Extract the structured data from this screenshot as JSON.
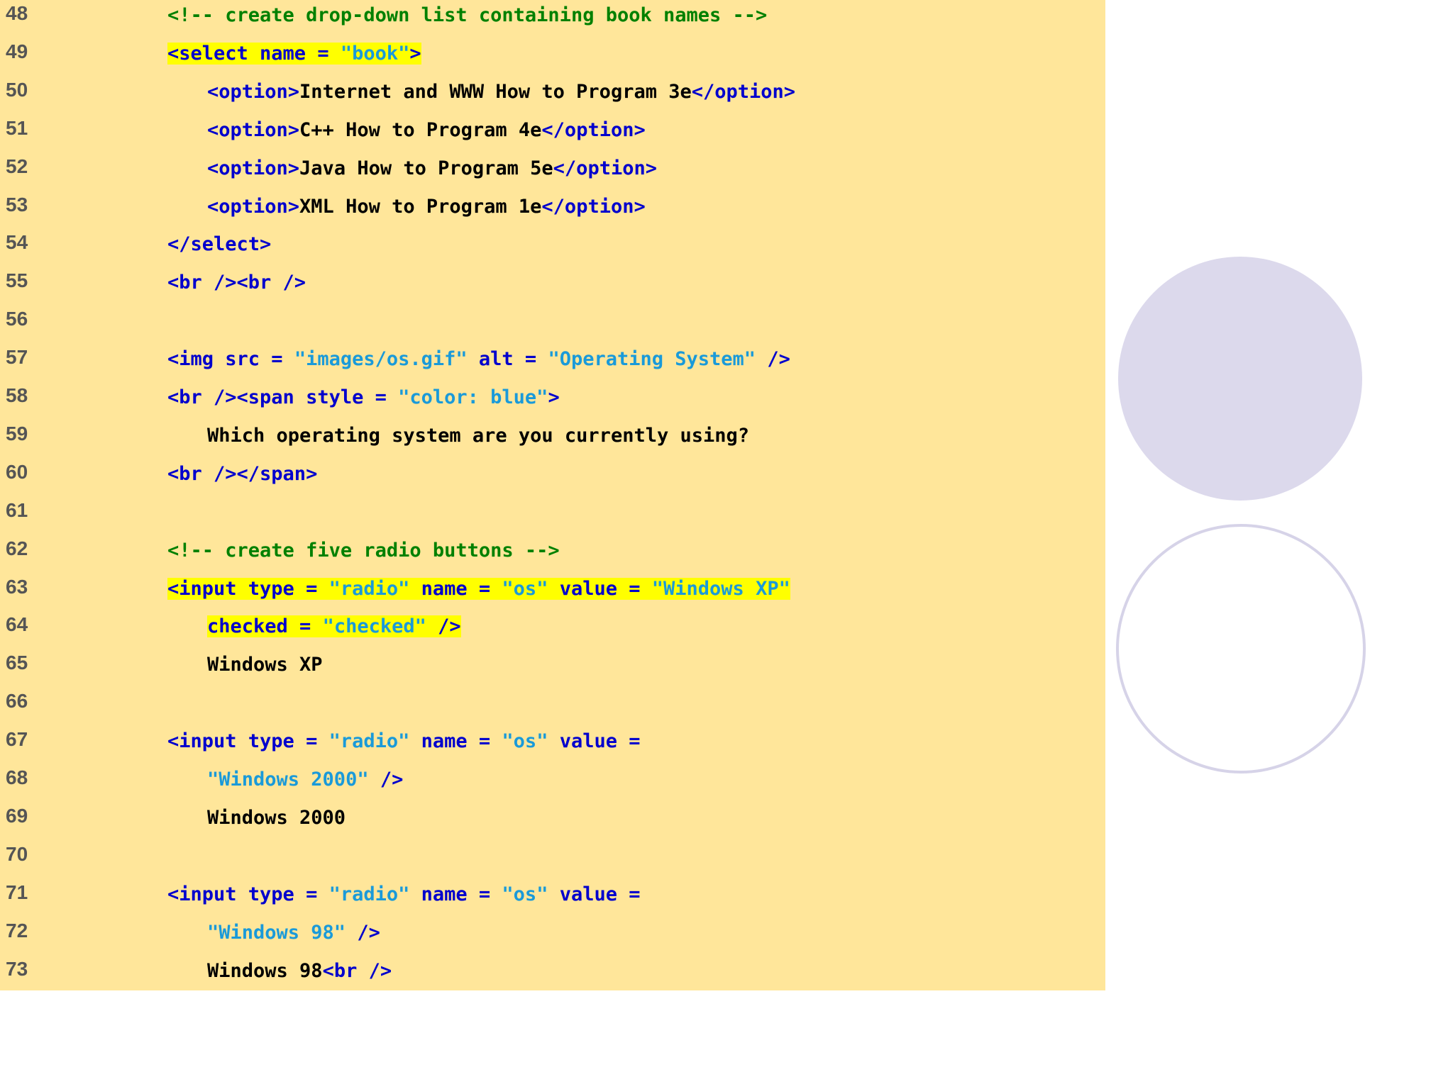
{
  "lines": [
    {
      "num": "48",
      "indent": 1,
      "tokens": [
        {
          "t": "<!-- create drop-down list containing book names -->",
          "c": "cm"
        }
      ]
    },
    {
      "num": "49",
      "indent": 1,
      "tokens": [
        {
          "t": "<select name = ",
          "c": "tag",
          "hl": true
        },
        {
          "t": "\"book\"",
          "c": "str",
          "hl": true
        },
        {
          "t": ">",
          "c": "tag",
          "hl": true
        }
      ]
    },
    {
      "num": "50",
      "indent": 2,
      "tokens": [
        {
          "t": "<option>",
          "c": "tag"
        },
        {
          "t": "Internet and WWW How to Program 3e",
          "c": "txt"
        },
        {
          "t": "</option>",
          "c": "tag"
        }
      ]
    },
    {
      "num": "51",
      "indent": 2,
      "tokens": [
        {
          "t": "<option>",
          "c": "tag"
        },
        {
          "t": "C++ How to Program 4e",
          "c": "txt"
        },
        {
          "t": "</option>",
          "c": "tag"
        }
      ]
    },
    {
      "num": "52",
      "indent": 2,
      "tokens": [
        {
          "t": "<option>",
          "c": "tag"
        },
        {
          "t": "Java How to Program 5e",
          "c": "txt"
        },
        {
          "t": "</option>",
          "c": "tag"
        }
      ]
    },
    {
      "num": "53",
      "indent": 2,
      "tokens": [
        {
          "t": "<option>",
          "c": "tag"
        },
        {
          "t": "XML How to Program 1e",
          "c": "txt"
        },
        {
          "t": "</option>",
          "c": "tag"
        }
      ]
    },
    {
      "num": "54",
      "indent": 1,
      "tokens": [
        {
          "t": "</select>",
          "c": "tag"
        }
      ]
    },
    {
      "num": "55",
      "indent": 1,
      "tokens": [
        {
          "t": "<br /><br />",
          "c": "tag"
        }
      ]
    },
    {
      "num": "56",
      "indent": 1,
      "tokens": []
    },
    {
      "num": "57",
      "indent": 1,
      "tokens": [
        {
          "t": "<img src = ",
          "c": "tag"
        },
        {
          "t": "\"images/os.gif\"",
          "c": "str"
        },
        {
          "t": " alt = ",
          "c": "tag"
        },
        {
          "t": "\"Operating System\"",
          "c": "str"
        },
        {
          "t": " />",
          "c": "tag"
        }
      ]
    },
    {
      "num": "58",
      "indent": 1,
      "tokens": [
        {
          "t": "<br /><span style = ",
          "c": "tag"
        },
        {
          "t": "\"color: blue\"",
          "c": "str"
        },
        {
          "t": ">",
          "c": "tag"
        }
      ]
    },
    {
      "num": "59",
      "indent": 2,
      "tokens": [
        {
          "t": "Which operating system are you currently using?",
          "c": "txt"
        }
      ]
    },
    {
      "num": "60",
      "indent": 1,
      "tokens": [
        {
          "t": "<br /></span>",
          "c": "tag"
        }
      ]
    },
    {
      "num": "61",
      "indent": 1,
      "tokens": []
    },
    {
      "num": "62",
      "indent": 1,
      "tokens": [
        {
          "t": "<!-- create five radio buttons -->",
          "c": "cm"
        }
      ]
    },
    {
      "num": "63",
      "indent": 1,
      "tokens": [
        {
          "t": "<input type = ",
          "c": "tag",
          "hl": true
        },
        {
          "t": "\"radio\"",
          "c": "str",
          "hl": true
        },
        {
          "t": " name = ",
          "c": "tag",
          "hl": true
        },
        {
          "t": "\"os\"",
          "c": "str",
          "hl": true
        },
        {
          "t": " value = ",
          "c": "tag",
          "hl": true
        },
        {
          "t": "\"Windows XP\"",
          "c": "str",
          "hl": true
        }
      ]
    },
    {
      "num": "64",
      "indent": 2,
      "tokens": [
        {
          "t": "checked = ",
          "c": "tag",
          "hl": true
        },
        {
          "t": "\"checked\"",
          "c": "str",
          "hl": true
        },
        {
          "t": " />",
          "c": "tag",
          "hl": true
        }
      ]
    },
    {
      "num": "65",
      "indent": 2,
      "tokens": [
        {
          "t": "Windows XP",
          "c": "txt"
        }
      ]
    },
    {
      "num": "66",
      "indent": 1,
      "tokens": []
    },
    {
      "num": "67",
      "indent": 1,
      "tokens": [
        {
          "t": "<input type = ",
          "c": "tag"
        },
        {
          "t": "\"radio\"",
          "c": "str"
        },
        {
          "t": " name = ",
          "c": "tag"
        },
        {
          "t": "\"os\"",
          "c": "str"
        },
        {
          "t": " value =",
          "c": "tag"
        }
      ]
    },
    {
      "num": "68",
      "indent": 2,
      "tokens": [
        {
          "t": "\"Windows 2000\"",
          "c": "str"
        },
        {
          "t": " />",
          "c": "tag"
        }
      ]
    },
    {
      "num": "69",
      "indent": 2,
      "tokens": [
        {
          "t": "Windows 2000",
          "c": "txt"
        }
      ]
    },
    {
      "num": "70",
      "indent": 1,
      "tokens": []
    },
    {
      "num": "71",
      "indent": 1,
      "tokens": [
        {
          "t": "<input type = ",
          "c": "tag"
        },
        {
          "t": "\"radio\"",
          "c": "str"
        },
        {
          "t": " name = ",
          "c": "tag"
        },
        {
          "t": "\"os\"",
          "c": "str"
        },
        {
          "t": " value =",
          "c": "tag"
        }
      ]
    },
    {
      "num": "72",
      "indent": 2,
      "tokens": [
        {
          "t": "\"Windows 98\"",
          "c": "str"
        },
        {
          "t": " />",
          "c": "tag"
        }
      ]
    },
    {
      "num": "73",
      "indent": 2,
      "tokens": [
        {
          "t": "Windows 98",
          "c": "txt"
        },
        {
          "t": "<br />",
          "c": "tag"
        }
      ]
    }
  ],
  "colors": {
    "panel_background": "#ffe69a",
    "comment": "#008000",
    "tag": "#0000cd",
    "string": "#1a9ad9",
    "text": "#000000",
    "highlight": "#ffff00",
    "line_number": "#555555",
    "decor_circle": "#dcd9ec"
  }
}
